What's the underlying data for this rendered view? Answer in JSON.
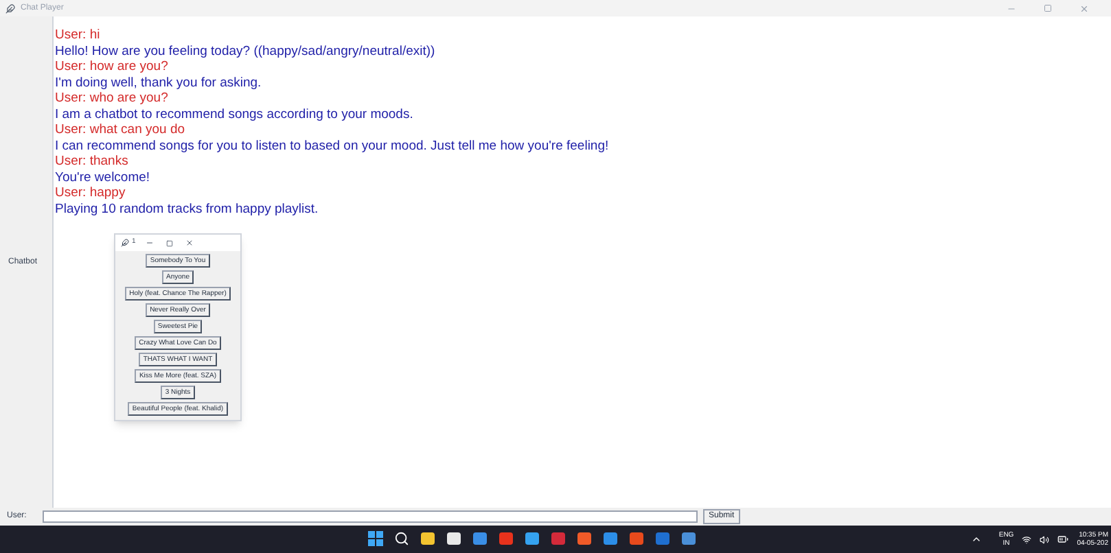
{
  "window": {
    "title": "Chat Player"
  },
  "sidebar": {
    "label": "Chatbot"
  },
  "messages": [
    {
      "kind": "user",
      "text": "User: hi"
    },
    {
      "kind": "bot",
      "text": "Hello! How are you feeling today? ((happy/sad/angry/neutral/exit))"
    },
    {
      "kind": "user",
      "text": "User: how are you?"
    },
    {
      "kind": "bot",
      "text": "I'm doing well, thank you for asking."
    },
    {
      "kind": "user",
      "text": "User: who are you?"
    },
    {
      "kind": "bot",
      "text": "I am a chatbot to recommend songs according to your moods."
    },
    {
      "kind": "user",
      "text": "User: what can you do"
    },
    {
      "kind": "bot",
      "text": "I can recommend songs for you to listen to based on your mood. Just tell me how you're feeling!"
    },
    {
      "kind": "user",
      "text": "User: thanks"
    },
    {
      "kind": "bot",
      "text": "You're welcome!"
    },
    {
      "kind": "user",
      "text": "User: happy"
    },
    {
      "kind": "bot",
      "text": "Playing 10 random tracks from happy playlist."
    }
  ],
  "popup": {
    "title": "1",
    "songs": [
      "Somebody To You",
      "Anyone",
      "Holy (feat. Chance The Rapper)",
      "Never Really Over",
      "Sweetest Pie",
      "Crazy What Love Can Do",
      "THATS WHAT I WANT",
      "Kiss Me More (feat. SZA)",
      "3 Nights",
      "Beautiful People (feat. Khalid)"
    ]
  },
  "input": {
    "label": "User:",
    "button": "Submit"
  },
  "tray": {
    "lang": "ENG",
    "region": "IN",
    "time": "10:35 PM",
    "date": "04-05-202"
  }
}
